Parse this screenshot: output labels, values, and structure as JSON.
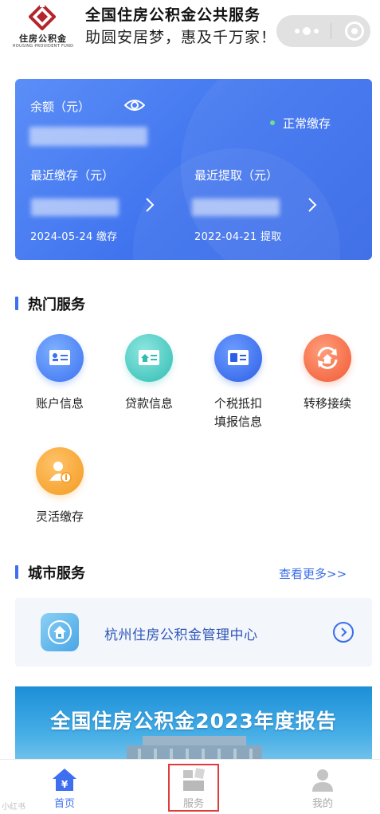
{
  "header": {
    "logo_text": "住房公积金",
    "logo_subtext": "HOUSING PROVIDENT FUND",
    "title": "全国住房公积金公共服务",
    "slogan": "助圆安居梦，惠及千万家！"
  },
  "balance_card": {
    "balance_label": "余额（元）",
    "status_label": "正常缴存",
    "recent_deposit_label": "最近缴存（元）",
    "recent_withdraw_label": "最近提取（元）",
    "deposit_date_text": "2024-05-24 缴存",
    "withdraw_date_text": "2022-04-21 提取"
  },
  "hot_services": {
    "title": "热门服务",
    "items": [
      {
        "label": "账户信息",
        "icon": "id-card-icon"
      },
      {
        "label": "贷款信息",
        "icon": "loan-card-icon"
      },
      {
        "label": "个税抵扣\n填报信息",
        "icon": "tax-card-icon"
      },
      {
        "label": "转移接续",
        "icon": "transfer-icon"
      },
      {
        "label": "灵活缴存",
        "icon": "flexible-deposit-icon"
      }
    ]
  },
  "city_services": {
    "title": "城市服务",
    "more_label": "查看更多>>",
    "items": [
      {
        "name": "杭州住房公积金管理中心",
        "icon": "housing-fund-center-icon"
      }
    ]
  },
  "banner": {
    "text": "全国住房公积金2023年度报告"
  },
  "tabbar": {
    "items": [
      {
        "label": "首页",
        "icon": "home-icon",
        "active": true
      },
      {
        "label": "服务",
        "icon": "service-icon",
        "active": false
      },
      {
        "label": "我的",
        "icon": "user-icon",
        "active": false
      }
    ]
  },
  "watermark": "小红书",
  "colors": {
    "primary": "#3e6ff0",
    "card_gradient_start": "#5b8ef7",
    "card_gradient_end": "#3668e6",
    "status_dot": "#6fe08d",
    "highlight_box": "#e23b3b"
  }
}
